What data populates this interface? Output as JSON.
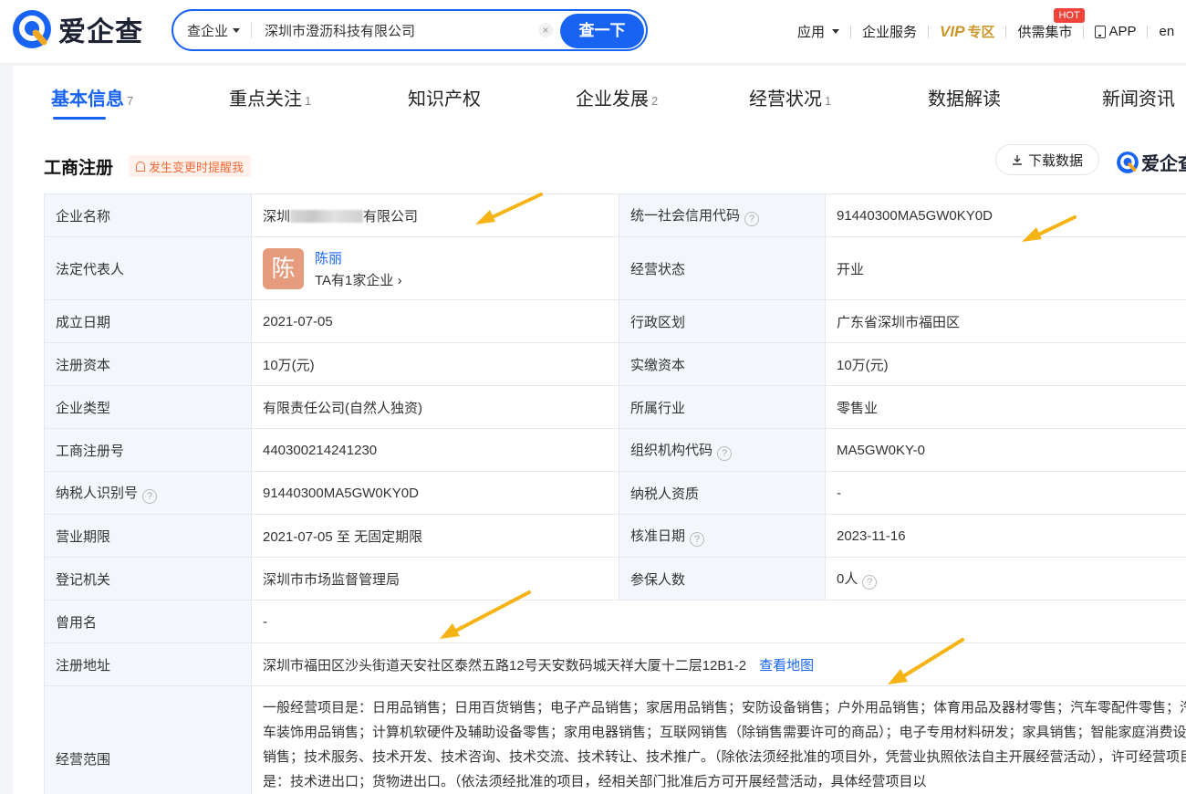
{
  "brand": {
    "name": "爱企查",
    "primary": "#1863f1",
    "arrow_color": "#f5b316"
  },
  "search": {
    "type": "查企业",
    "value": "深圳市澄沥科技有限公司",
    "clear_icon": "close-icon",
    "button": "查一下"
  },
  "topnav": {
    "apps": "应用",
    "service": "企业服务",
    "vip": "VIP",
    "vip_zone": "专区",
    "market": "供需集市",
    "hot": "HOT",
    "app": "APP",
    "lang": "en"
  },
  "tabs": [
    {
      "label": "基本信息",
      "count": "7"
    },
    {
      "label": "重点关注",
      "count": "1"
    },
    {
      "label": "知识产权",
      "count": ""
    },
    {
      "label": "企业发展",
      "count": "2"
    },
    {
      "label": "经营状况",
      "count": "1"
    },
    {
      "label": "数据解读",
      "count": ""
    },
    {
      "label": "新闻资讯",
      "count": ""
    }
  ],
  "section": {
    "title": "工商注册",
    "remind": "发生变更时提醒我",
    "download": "下载数据",
    "brand_mini": "爱企查"
  },
  "info": {
    "company_name_label": "企业名称",
    "company_name_prefix": "深圳",
    "company_name_suffix": "有限公司",
    "credit_code_label": "统一社会信用代码",
    "credit_code": "91440300MA5GW0KY0D",
    "legal_rep_label": "法定代表人",
    "legal_rep_avatar": "陈",
    "legal_rep_name": "陈丽",
    "legal_rep_sub": "TA有1家企业",
    "status_label": "经营状态",
    "status": "开业",
    "founded_label": "成立日期",
    "founded": "2021-07-05",
    "region_label": "行政区划",
    "region": "广东省深圳市福田区",
    "reg_capital_label": "注册资本",
    "reg_capital": "10万(元)",
    "paid_capital_label": "实缴资本",
    "paid_capital": "10万(元)",
    "type_label": "企业类型",
    "type": "有限责任公司(自然人独资)",
    "industry_label": "所属行业",
    "industry": "零售业",
    "reg_no_label": "工商注册号",
    "reg_no": "440300214241230",
    "org_code_label": "组织机构代码",
    "org_code": "MA5GW0KY-0",
    "taxpayer_id_label": "纳税人识别号",
    "taxpayer_id": "91440300MA5GW0KY0D",
    "taxpayer_qual_label": "纳税人资质",
    "taxpayer_qual": "-",
    "term_label": "营业期限",
    "term": "2021-07-05 至 无固定期限",
    "approval_label": "核准日期",
    "approval": "2023-11-16",
    "authority_label": "登记机关",
    "authority": "深圳市市场监督管理局",
    "insured_label": "参保人数",
    "insured": "0人",
    "former_name_label": "曾用名",
    "former_name": "-",
    "address_label": "注册地址",
    "address": "深圳市福田区沙头街道天安社区泰然五路12号天安数码城天祥大厦十二层12B1-2",
    "map_link": "查看地图",
    "scope_label": "经营范围",
    "scope": "一般经营项目是：日用品销售；日用百货销售；电子产品销售；家居用品销售；安防设备销售；户外用品销售；体育用品及器材零售；汽车零配件零售；汽车装饰用品销售；计算机软硬件及辅助设备零售；家用电器销售；互联网销售（除销售需要许可的商品）；电子专用材料研发；家具销售；智能家庭消费设备销售；技术服务、技术开发、技术咨询、技术交流、技术转让、技术推广。（除依法须经批准的项目外，凭营业执照依法自主开展经营活动），许可经营项目是：技术进出口；货物进出口。（依法须经批准的项目，经相关部门批准后方可开展经营活动，具体经营项目以"
  }
}
